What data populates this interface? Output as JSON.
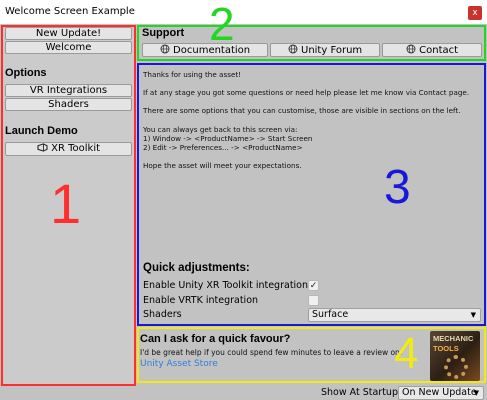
{
  "window": {
    "title": "Welcome Screen Example",
    "close_label": "x"
  },
  "sidebar": {
    "top_buttons": [
      "New Update!",
      "Welcome"
    ],
    "options_label": "Options",
    "options_buttons": [
      "VR Integrations",
      "Shaders"
    ],
    "launch_label": "Launch Demo",
    "launch_button": "XR Toolkit",
    "launch_icon": "vr-headset-icon"
  },
  "support": {
    "label": "Support",
    "buttons": [
      {
        "label": "Documentation",
        "icon": "globe-icon"
      },
      {
        "label": "Unity Forum",
        "icon": "globe-icon"
      },
      {
        "label": "Contact",
        "icon": "globe-icon"
      }
    ]
  },
  "main": {
    "lines": [
      "Thanks for using the asset!",
      "If at any stage you got some questions or need help please let me know via Contact page.",
      "There are some options that you can customise, those are visible in sections on the left.",
      "You can always get back to this screen via:",
      "1) Window -> <ProductName> -> Start Screen",
      "2) Edit -> Preferences... -> <ProductName>",
      "Hope the asset will meet your expectations."
    ]
  },
  "quick": {
    "title": "Quick adjustments:",
    "xr_label": "Enable Unity XR Toolkit integration",
    "xr_checked": "✓",
    "vrtk_label": "Enable VRTK integration",
    "vrtk_checked": "",
    "shaders_label": "Shaders",
    "shaders_value": "Surface",
    "dropdown_arrow": "▼"
  },
  "favour": {
    "title": "Can I ask for a quick favour?",
    "text": "I'd be great help if you could spend few minutes to leave a review on:",
    "link": "Unity Asset Store",
    "logo_line1": "MECHANIC",
    "logo_line2": "TOOLS"
  },
  "footer": {
    "startup_label": "Show At Startup",
    "startup_value": "On New Update",
    "dropdown_arrow": "▼"
  },
  "annotations": {
    "numbers": [
      "1",
      "2",
      "3",
      "4"
    ],
    "colors": {
      "1": "#ff2d2d",
      "2": "#22d622",
      "3": "#1818d8",
      "4": "#f2ea10"
    }
  }
}
